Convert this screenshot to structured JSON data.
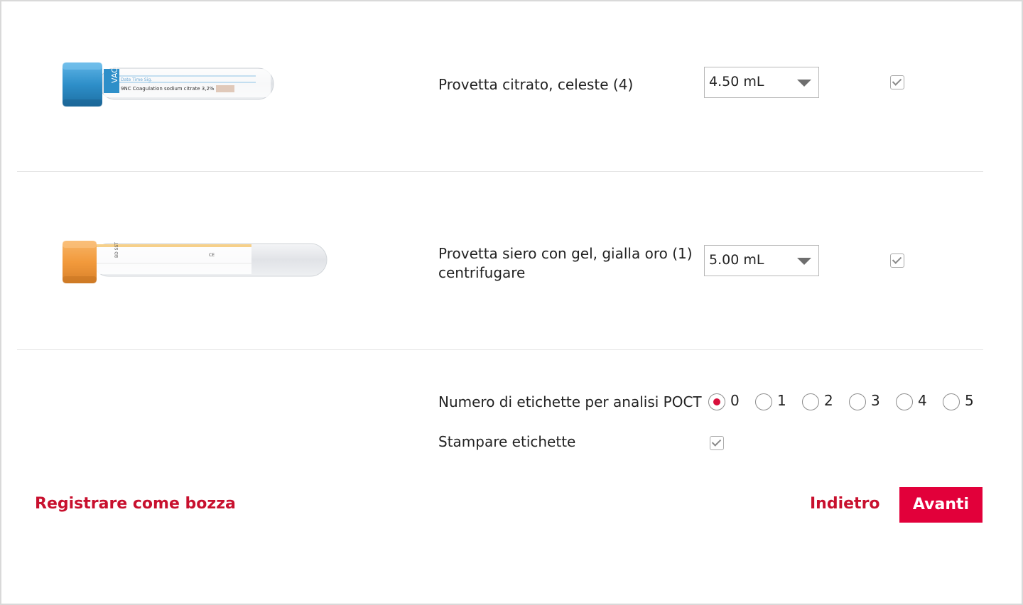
{
  "tubes": [
    {
      "label": "Provetta citrato, celeste (4)",
      "volume": "4.50 mL",
      "checked": true,
      "cap_color": "#2e8fc9",
      "image_text": "9NC Coagulation sodium citrate 3,2%"
    },
    {
      "label_line1": "Provetta siero con gel, gialla oro (1)",
      "label_line2": "centrifugare",
      "volume": "5.00 mL",
      "checked": true,
      "cap_color": "#f29a3c"
    }
  ],
  "poct": {
    "label": "Numero di etichette per analisi POCT",
    "options": [
      "0",
      "1",
      "2",
      "3",
      "4",
      "5"
    ],
    "selected": "0"
  },
  "print_labels": {
    "label": "Stampare etichette",
    "checked": true
  },
  "actions": {
    "draft_label": "Registrare come bozza",
    "back_label": "Indietro",
    "next_label": "Avanti"
  },
  "colors": {
    "accent": "#e2003a",
    "link": "#c8102e"
  }
}
